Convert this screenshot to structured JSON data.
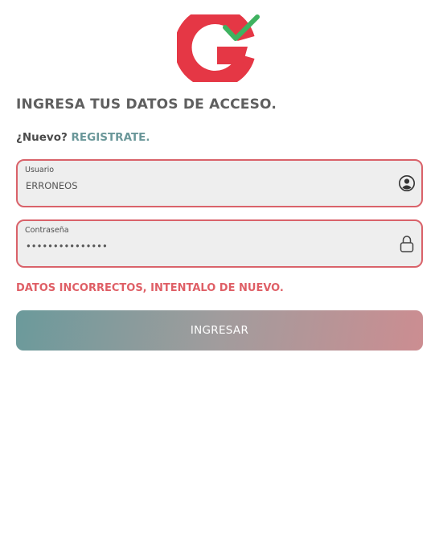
{
  "colors": {
    "accent_red": "#e53745",
    "check_green": "#3fb260",
    "link_teal": "#6a9799",
    "error_red": "#df5f66",
    "field_border": "#d9626a",
    "field_bg": "#eeeeee",
    "button_gradient_start": "#6b9a9b",
    "button_gradient_end": "#cc8d91"
  },
  "logo": {
    "icon": "g-checkmark-logo"
  },
  "form": {
    "heading": "INGRESA TUS DATOS DE ACCESO.",
    "new_prompt": "¿Nuevo?",
    "register_link": "REGISTRATE.",
    "username": {
      "label": "Usuario",
      "value": "ERRONEOS",
      "icon": "user-circle-icon"
    },
    "password": {
      "label": "Contraseña",
      "value": "•••••••••••••••",
      "icon": "lock-icon"
    },
    "error_message": "DATOS INCORRECTOS, INTENTALO DE NUEVO.",
    "submit_label": "INGRESAR"
  }
}
